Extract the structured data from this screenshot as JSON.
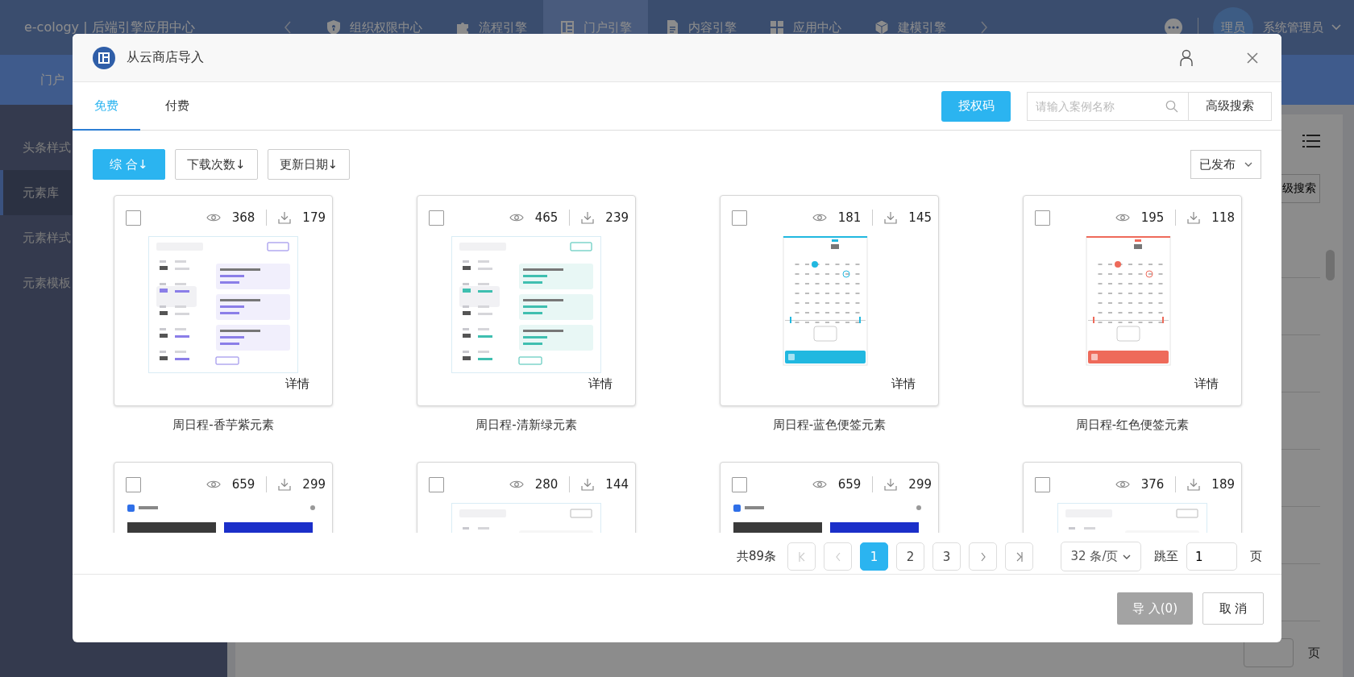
{
  "top_nav": {
    "brand": "e-cology | 后端引擎应用中心",
    "items": [
      {
        "label": "组织权限中心",
        "selected": false
      },
      {
        "label": "流程引擎",
        "selected": false
      },
      {
        "label": "门户引擎",
        "selected": true
      },
      {
        "label": "内容引擎",
        "selected": false
      },
      {
        "label": "应用中心",
        "selected": false
      },
      {
        "label": "建模引擎",
        "selected": false
      }
    ],
    "user": {
      "avatar_text": "理员",
      "name": "系统管理员"
    }
  },
  "sub_nav": {
    "label": "门户"
  },
  "sidebar": {
    "items": [
      {
        "label": "头条样式",
        "selected": false
      },
      {
        "label": "元素库",
        "selected": true
      },
      {
        "label": "元素样式",
        "selected": false
      },
      {
        "label": "元素模板",
        "selected": false
      }
    ]
  },
  "background_panel": {
    "search_button": "级搜索",
    "page_suffix": "页"
  },
  "dialog": {
    "title": "从云商店导入",
    "tabs": [
      {
        "label": "免费",
        "selected": true
      },
      {
        "label": "付费",
        "selected": false
      }
    ],
    "auth_button": "授权码",
    "search": {
      "placeholder": "请输入案例名称"
    },
    "advanced_search": "高级搜索",
    "sort_buttons": [
      {
        "label": "综 合↓",
        "selected": true
      },
      {
        "label": "下载次数↓",
        "selected": false
      },
      {
        "label": "更新日期↓",
        "selected": false
      }
    ],
    "status_select": "已发布",
    "cards": [
      {
        "checked": false,
        "views": "368",
        "downloads": "179",
        "detail": "详情",
        "title": "周日程-香芋紫元素",
        "preview": {
          "kind": "schedule",
          "color": "#8b7ee8"
        }
      },
      {
        "checked": false,
        "views": "465",
        "downloads": "239",
        "detail": "详情",
        "title": "周日程-清新绿元素",
        "preview": {
          "kind": "schedule",
          "color": "#3fbfb0"
        }
      },
      {
        "checked": false,
        "views": "181",
        "downloads": "145",
        "detail": "详情",
        "title": "周日程-蓝色便签元素",
        "preview": {
          "kind": "calendar",
          "color": "#21b8e0"
        }
      },
      {
        "checked": false,
        "views": "195",
        "downloads": "118",
        "detail": "详情",
        "title": "周日程-红色便签元素",
        "preview": {
          "kind": "calendar",
          "color": "#ee6a5a"
        }
      },
      {
        "checked": false,
        "views": "659",
        "downloads": "299",
        "preview": {
          "kind": "news"
        }
      },
      {
        "checked": false,
        "views": "280",
        "downloads": "144",
        "preview": {
          "kind": "schedule"
        }
      },
      {
        "checked": false,
        "views": "659",
        "downloads": "299",
        "preview": {
          "kind": "news"
        }
      },
      {
        "checked": false,
        "views": "376",
        "downloads": "189",
        "preview": {
          "kind": "schedule"
        }
      }
    ],
    "pagination": {
      "total": "共89条",
      "pages": [
        {
          "label": "1",
          "selected": true
        },
        {
          "label": "2",
          "selected": false
        },
        {
          "label": "3",
          "selected": false
        }
      ],
      "page_size": "32 条/页",
      "jump_label": "跳至",
      "jump_value": "1",
      "page_suffix": "页"
    },
    "footer": {
      "import_button": {
        "label": "导 入(0)",
        "disabled": true
      },
      "cancel_button": "取 消"
    }
  }
}
